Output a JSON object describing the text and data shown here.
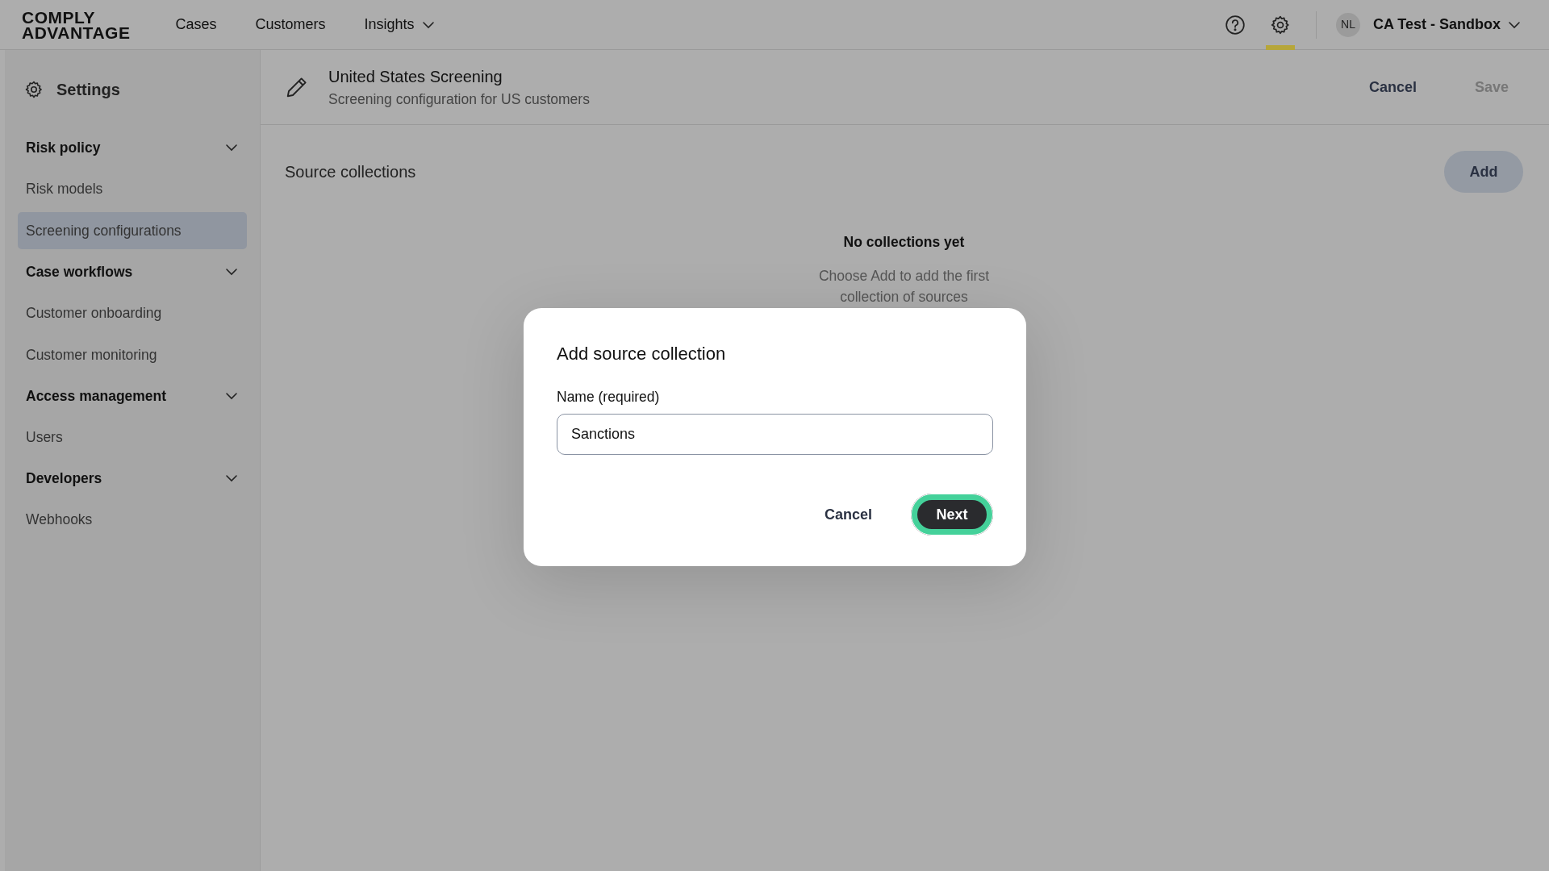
{
  "brand": {
    "line1": "COMPLY",
    "line2": "ADVANTAGE"
  },
  "nav": [
    {
      "label": "Cases",
      "dropdown": false
    },
    {
      "label": "Customers",
      "dropdown": false
    },
    {
      "label": "Insights",
      "dropdown": true
    }
  ],
  "toolbar": [
    {
      "kind": "help",
      "selected": false
    },
    {
      "kind": "settings",
      "selected": true
    }
  ],
  "account": {
    "initials": "NL",
    "name": "CA Test - Sandbox"
  },
  "sidebar": {
    "title": "Settings",
    "groups": [
      {
        "label": "Risk policy",
        "expanded": true,
        "items": [
          {
            "label": "Risk models",
            "selected": false
          },
          {
            "label": "Screening configurations",
            "selected": true
          }
        ]
      },
      {
        "label": "Case workflows",
        "expanded": true,
        "items": [
          {
            "label": "Customer onboarding",
            "selected": false
          },
          {
            "label": "Customer monitoring",
            "selected": false
          }
        ]
      },
      {
        "label": "Access management",
        "expanded": true,
        "items": [
          {
            "label": "Users",
            "selected": false
          }
        ]
      },
      {
        "label": "Developers",
        "expanded": true,
        "items": [
          {
            "label": "Webhooks",
            "selected": false
          }
        ]
      }
    ]
  },
  "header": {
    "title": "United States Screening",
    "subtitle": "Screening configuration for US customers",
    "cancel": "Cancel",
    "save": "Save",
    "save_disabled": true
  },
  "section": {
    "title": "Source collections",
    "add": "Add",
    "empty_title": "No collections yet",
    "empty_text": "Choose Add to add the first collection of sources"
  },
  "modal": {
    "title": "Add source collection",
    "field_label": "Name (required)",
    "field_value": "Sanctions",
    "cancel": "Cancel",
    "next": "Next",
    "next_focused": true
  }
}
